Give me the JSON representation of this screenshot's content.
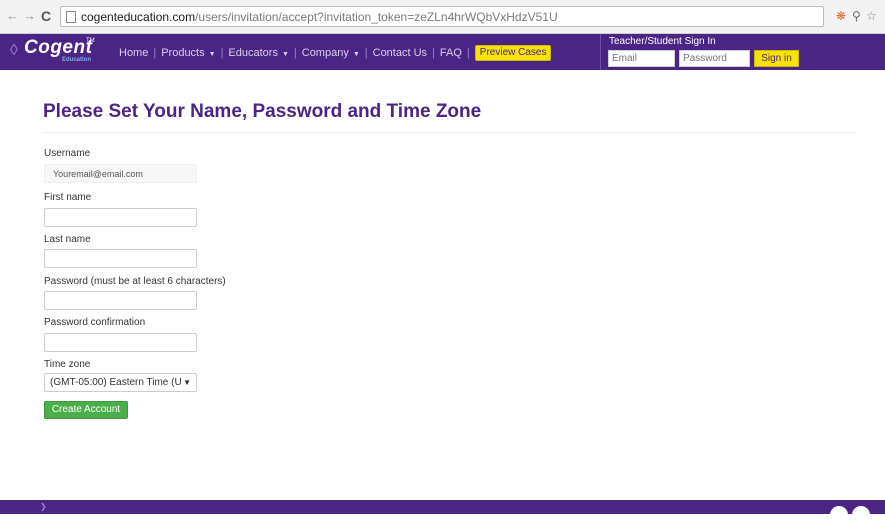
{
  "browser": {
    "url_host": "cogenteducation.com",
    "url_path": "/users/invitation/accept?invitation_token=zeZLn4hrWQbVxHdzV51U",
    "back_glyph": "←",
    "forward_glyph": "→",
    "reload_glyph": "C",
    "extension_icons": [
      "extension-icon",
      "pin-icon",
      "star-icon"
    ]
  },
  "header": {
    "logo_text": "Cogent",
    "logo_tm": "TM",
    "logo_sub": "Education",
    "nav": {
      "home": "Home",
      "products": "Products",
      "educators": "Educators",
      "company": "Company",
      "contact": "Contact Us",
      "faq": "FAQ",
      "preview": "Preview Cases",
      "caret": "▼",
      "separator": "|"
    },
    "signin": {
      "title": "Teacher/Student Sign In",
      "email_placeholder": "Email",
      "password_placeholder": "Password",
      "button": "Sign in"
    }
  },
  "form": {
    "title": "Please Set Your Name, Password and Time Zone",
    "username_label": "Username",
    "username_value": "Youremail@email.com",
    "first_name_label": "First name",
    "last_name_label": "Last name",
    "password_label": "Password (must be at least 6 characters)",
    "password_confirm_label": "Password confirmation",
    "timezone_label": "Time zone",
    "timezone_value": "(GMT-05:00) Eastern Time (U",
    "timezone_caret": "▼",
    "submit": "Create Account"
  },
  "colors": {
    "brand_purple": "#4b2585",
    "accent_yellow": "#f6e300",
    "submit_green": "#4aae4a"
  }
}
